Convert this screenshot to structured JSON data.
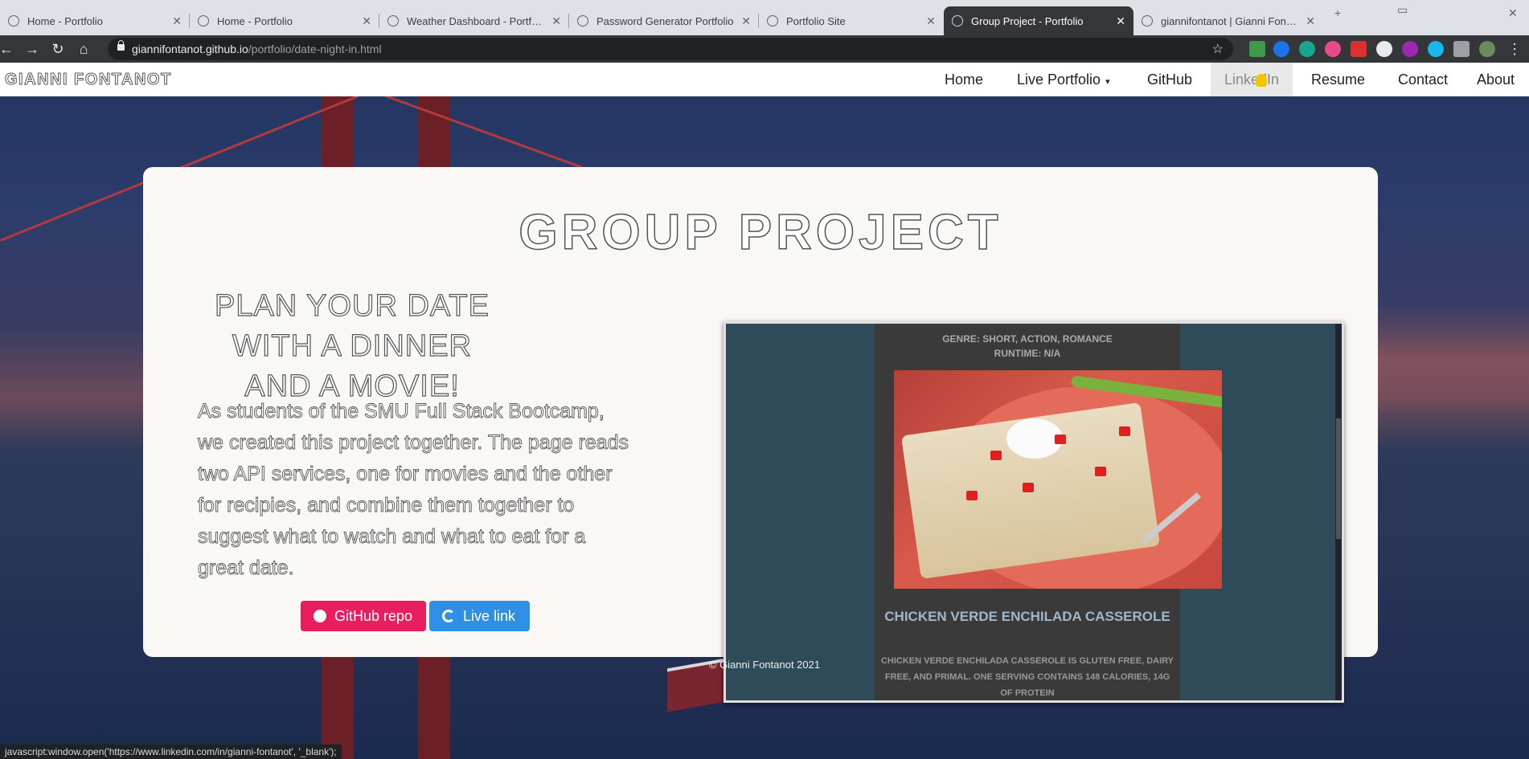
{
  "browser": {
    "tabs": [
      {
        "title": "Home - Portfolio"
      },
      {
        "title": "Home - Portfolio"
      },
      {
        "title": "Weather Dashboard - Portfolio"
      },
      {
        "title": "Password Generator Portfolio"
      },
      {
        "title": "Portfolio Site"
      },
      {
        "title": "Group Project - Portfolio",
        "active": true
      },
      {
        "title": "giannifontanot | Gianni Fontanot"
      }
    ],
    "url_host": "giannifontanot.github.io",
    "url_path": "/portfolio/date-night-in.html"
  },
  "navbar": {
    "brand": "GIANNI FONTANOT",
    "links": [
      "Home",
      "Live Portfolio",
      "GitHub",
      "LinkedIn",
      "Resume",
      "Contact",
      "About"
    ],
    "hovered": "LinkedIn"
  },
  "card": {
    "title": "GROUP PROJECT",
    "headline": "PLAN YOUR DATE WITH A DINNER AND A MOVIE!",
    "description": "As students of the SMU Full Stack Bootcamp, we created this project together. The page reads two API services, one for movies and the other for recipies, and combine them together to suggest what to watch and what to eat for a great date.",
    "github_button": "GitHub repo",
    "live_button": "Live link"
  },
  "preview": {
    "top_line1": "GENRE: SHORT, ACTION, ROMANCE",
    "top_line2": "RUNTIME: N/A",
    "recipe_name": "CHICKEN VERDE ENCHILADA CASSEROLE",
    "recipe_desc": "CHICKEN VERDE ENCHILADA CASSEROLE IS GLUTEN FREE, DAIRY FREE, AND PRIMAL. ONE SERVING CONTAINS 148 CALORIES, 14G OF PROTEIN"
  },
  "footer": "© Gianni Fontanot 2021",
  "status_bar": "javascript:window.open('https://www.linkedin.com/in/gianni-fontanot', '_blank');"
}
